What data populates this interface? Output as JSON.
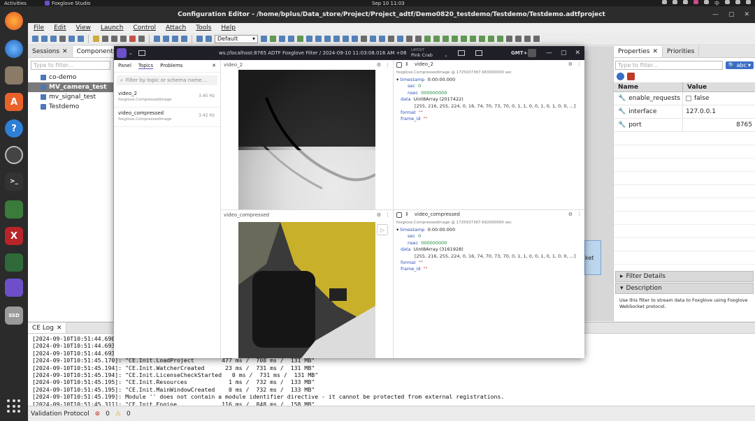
{
  "topbar": {
    "activities": "Activities",
    "app_name": "Foxglove Studio",
    "clock": "Sep 10  11:03",
    "lang": "中"
  },
  "window": {
    "title": "Configuration Editor - /home/bplus/Data_store/Project/Project_adtf/Demo0820_testdemo/Testdemo/Testdemo.adtfproject"
  },
  "menu": [
    "File",
    "Edit",
    "View",
    "Launch",
    "Control",
    "Attach",
    "Tools",
    "Help"
  ],
  "toolbar": {
    "default_select": "Default"
  },
  "left_panel": {
    "tabs": [
      "Sessions",
      "Components"
    ],
    "filter_placeholder": "Type to filter...",
    "items": [
      "co-demo",
      "MV_camera_test",
      "mv_signal_test",
      "Testdemo"
    ]
  },
  "right_panel": {
    "tabs": [
      "Properties",
      "Priorities"
    ],
    "filter_placeholder": "Type to filter...",
    "abc_button": "abc",
    "columns": [
      "Name",
      "Value"
    ],
    "rows": [
      {
        "name": "enable_requests",
        "value": "false"
      },
      {
        "name": "interface",
        "value": "127.0.0.1"
      },
      {
        "name": "port",
        "value": "8765"
      }
    ],
    "filter_details": "Filter Details",
    "description_title": "Description",
    "description_text": "Use this filter to stream data to Foxglove using Foxglove WebSocket protocol."
  },
  "center": {
    "node_label": "ket"
  },
  "log": {
    "tab": "CE Log",
    "lines": [
      "[2024-09-10T10:51:44.690]: \"CE.",
      "[2024-09-10T10:51:44.693]: \"CE.",
      "[2024-09-10T10:51:44.693]: \"CE.",
      "[2024-09-10T10:51:45.170]: \"CE.Init.LoadProject        477 ms /  708 ms /  131 MB\"",
      "[2024-09-10T10:51:45.194]: \"CE.Init.WatcherCreated      23 ms /  731 ms /  131 MB\"",
      "[2024-09-10T10:51:45.194]: \"CE.Init.LicenseCheckStarted   0 ms /  731 ms /  131 MB\"",
      "[2024-09-10T10:51:45.195]: \"CE.Init.Resources            1 ms /  732 ms /  133 MB\"",
      "[2024-09-10T10:51:45.195]: \"CE.Init.MainWindowCreated    0 ms /  732 ms /  133 MB\"",
      "[2024-09-10T10:51:45.199]: Module '' does not contain a module identifier directive - it cannot be protected from external registrations.",
      "[2024-09-10T10:51:45.311]: \"CE.Init.Engine             116 ms /  848 ms /  158 MB\""
    ]
  },
  "statusbar": {
    "label": "Validation Protocol",
    "errors": "0",
    "warnings": "0"
  },
  "foxglove": {
    "url_title": "ws://localhost:8765 ADTF Foxglove Filter / 2024-09-10 11:03:08.016 AM +08",
    "layout_label": "LAYOUT",
    "layout_name": "Pink Crab",
    "timezone": "GMT+8",
    "side_tabs": [
      "Panel",
      "Topics",
      "Problems"
    ],
    "topic_filter_placeholder": "Filter by topic or schema name…",
    "topics": [
      {
        "name": "video_2",
        "schema": "foxglove.CompressedImage",
        "hz": "3.45 Hz"
      },
      {
        "name": "video_compressed",
        "schema": "foxglove.CompressedImage",
        "hz": "3.42 Hz"
      }
    ],
    "image_panels": [
      {
        "title": "video_2"
      },
      {
        "title": "video_compressed"
      }
    ],
    "raw_panels": [
      {
        "title": "video_2",
        "header": "foxglove.CompressedImage @ 1725937387.683000000 sec",
        "timestamp_label": "timestamp",
        "timestamp_value": "0:00:00.000",
        "sec_label": "sec",
        "sec": "0",
        "nsec_label": "nsec",
        "nsec": "000000000",
        "data_label": "data",
        "data_type": "Uint8Array (2017422)",
        "data_values": "[255, 216, 255, 224, 0, 16, 74, 70, 73, 70, 0, 1, 1, 0, 0, 1, 0, 1, 0, 0, ...]",
        "format_label": "format",
        "format": "\"\"",
        "frame_label": "frame_id",
        "frame": "\"\""
      },
      {
        "title": "video_compressed",
        "header": "foxglove.CompressedImage @ 1725937387.692000000 sec",
        "timestamp_label": "timestamp",
        "timestamp_value": "0:00:00.000",
        "sec_label": "sec",
        "sec": "0",
        "nsec_label": "nsec",
        "nsec": "000000000",
        "data_label": "data",
        "data_type": "Uint8Array (3161928)",
        "data_values": "[255, 216, 255, 224, 0, 16, 74, 70, 73, 70, 0, 1, 1, 0, 0, 1, 0, 1, 0, 0, ...]",
        "format_label": "format",
        "format": "\"\"",
        "frame_label": "frame_id",
        "frame": "\"\""
      }
    ]
  }
}
